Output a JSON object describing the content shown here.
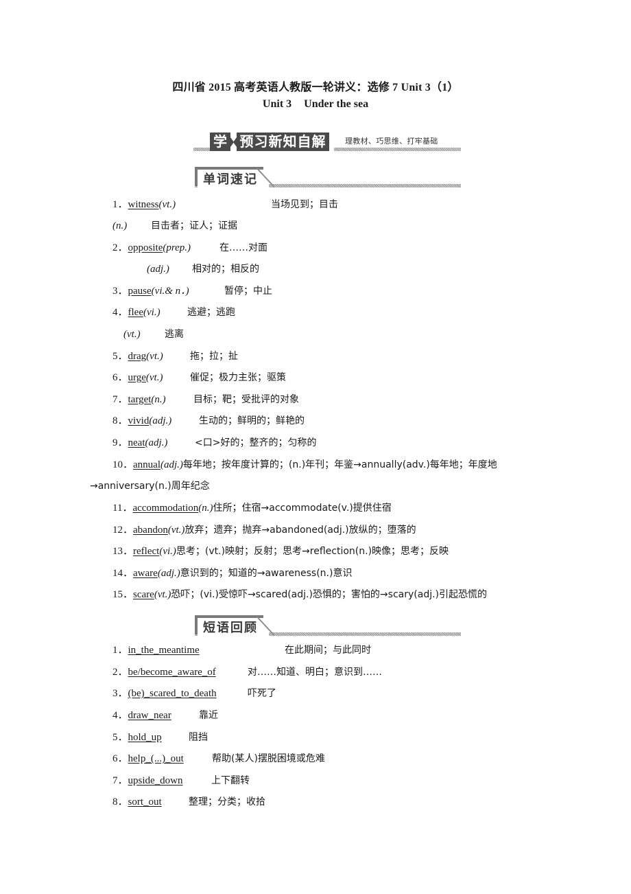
{
  "document": {
    "title": "四川省 2015 高考英语人教版一轮讲义：选修 7 Unit 3（1）",
    "subtitle_unit": "Unit 3",
    "subtitle_name": "Under the sea"
  },
  "main_banner": {
    "badge": "学",
    "heading": "预习新知自解",
    "tagline": "理教材、巧思维、打牢基础"
  },
  "sections": [
    {
      "label": "单词速记",
      "items": [
        {
          "num": "1．",
          "word": "witness",
          "pos": "(vt.)",
          "meaning": "当场见到；目击"
        },
        {
          "num": "",
          "word": "",
          "pos": "(n.)",
          "meaning": "目击者；证人；证据"
        },
        {
          "num": "2．",
          "word": "opposite",
          "pos": "(prep.)",
          "meaning": "在……对面"
        },
        {
          "num": "",
          "word": "",
          "pos": "(adj.)",
          "meaning": "相对的；相反的"
        },
        {
          "num": "3．",
          "word": "pause",
          "pos": "(vi.& n．)",
          "meaning": "暂停；中止"
        },
        {
          "num": "4．",
          "word": "flee",
          "pos": "(vi.)",
          "meaning": "逃避；逃跑"
        },
        {
          "num": "",
          "word": "",
          "pos": "(vt.)",
          "meaning": "逃离"
        },
        {
          "num": "5．",
          "word": "drag",
          "pos": "(vt.)",
          "meaning": "拖；拉；扯"
        },
        {
          "num": "6．",
          "word": "urge",
          "pos": "(vt.)",
          "meaning": "催促；极力主张；驱策"
        },
        {
          "num": "7．",
          "word": "target",
          "pos": "(n.)",
          "meaning": "目标；靶；受批评的对象"
        },
        {
          "num": "8．",
          "word": "vivid",
          "pos": "(adj.)",
          "meaning": "生动的；鲜明的；鲜艳的"
        },
        {
          "num": "9．",
          "word": "neat",
          "pos": "(adj.)",
          "meaning": "<口>好的；整齐的；匀称的"
        },
        {
          "num": "10．",
          "word": "annual",
          "pos": "(adj.)",
          "meaning": "每年地；按年度计算的；(n.)年刊；年鉴→annually(adv.)每年地；年度地",
          "continuation": "→anniversary(n.)周年纪念"
        },
        {
          "num": "11．",
          "word": "accommodation",
          "pos": "(n.)",
          "meaning": "住所；住宿→accommodate(v.)提供住宿"
        },
        {
          "num": "12．",
          "word": "abandon",
          "pos": "(vt.)",
          "meaning": "放弃；遗弃；抛弃→abandoned(adj.)放纵的；堕落的"
        },
        {
          "num": "13．",
          "word": "reflect",
          "pos": "(vi.)",
          "meaning": "思考；(vt.)映射；反射；思考→reflection(n.)映像；思考；反映"
        },
        {
          "num": "14．",
          "word": "aware",
          "pos": "(adj.)",
          "meaning": "意识到的；知道的→awareness(n.)意识"
        },
        {
          "num": "15．",
          "word": "scare",
          "pos": "(vt.)",
          "meaning": "恐吓；(vi.)受惊吓→scared(adj.)恐惧的；害怕的→scary(adj.)引起恐慌的"
        }
      ]
    },
    {
      "label": "短语回顾",
      "items": [
        {
          "num": "1．",
          "phrase": "in_the_meantime",
          "meaning": "在此期间；与此同时"
        },
        {
          "num": "2．",
          "phrase": "be/become_aware_of",
          "meaning": "对……知道、明白；意识到……"
        },
        {
          "num": "3．",
          "phrase": "(be)_scared_to_death",
          "meaning": "吓死了"
        },
        {
          "num": "4．",
          "phrase": "draw_near",
          "meaning": "靠近"
        },
        {
          "num": "5．",
          "phrase": "hold_up",
          "meaning": "阻挡"
        },
        {
          "num": "6．",
          "phrase": "help_(...)_out",
          "meaning": "帮助(某人)摆脱困境或危难"
        },
        {
          "num": "7．",
          "phrase": "upside_down",
          "meaning": "上下翻转"
        },
        {
          "num": "8．",
          "phrase": "sort_out",
          "meaning": "整理；分类；收拾"
        }
      ]
    }
  ]
}
